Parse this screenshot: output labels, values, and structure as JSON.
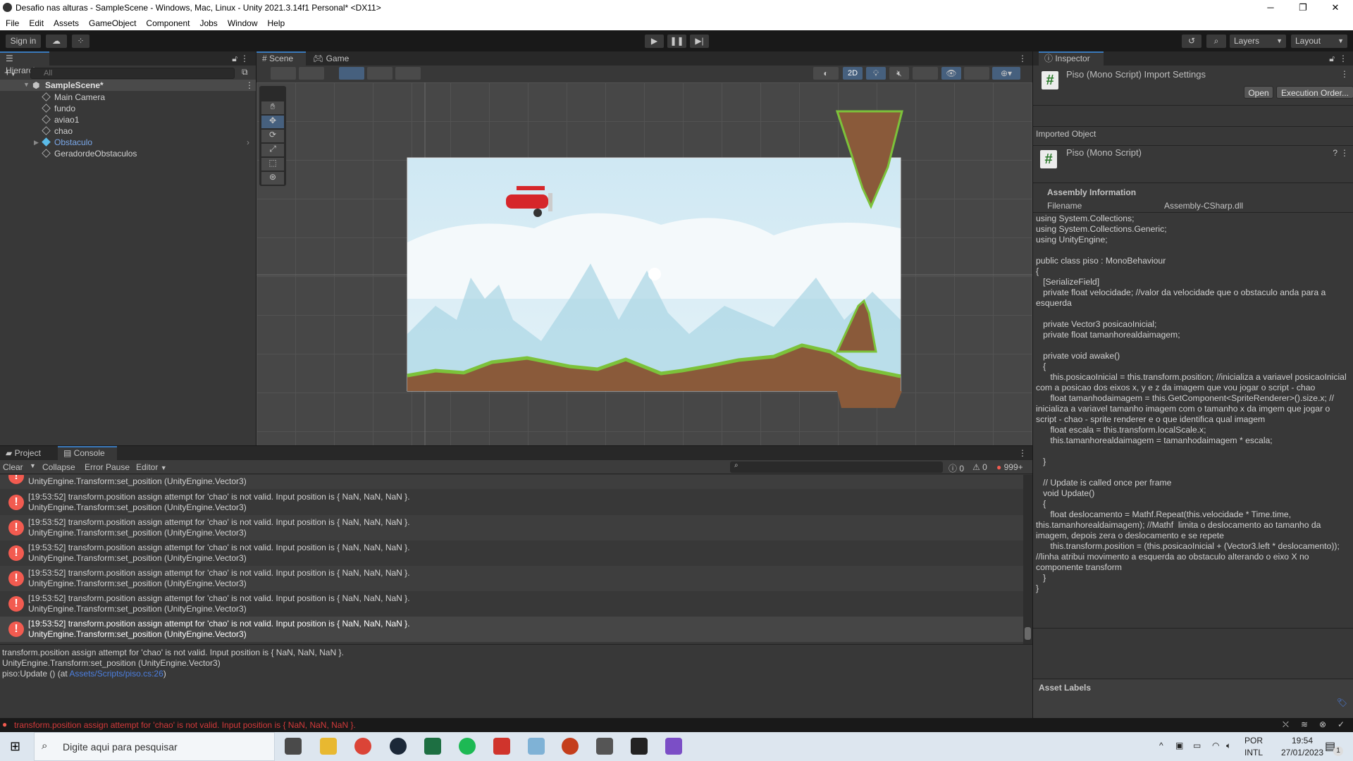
{
  "window": {
    "title": "Desafio nas alturas - SampleScene - Windows, Mac, Linux - Unity 2021.3.14f1 Personal* <DX11>",
    "minimize": "─",
    "maximize": "❐",
    "close": "✕"
  },
  "menu": [
    "File",
    "Edit",
    "Assets",
    "GameObject",
    "Component",
    "Jobs",
    "Window",
    "Help"
  ],
  "toolbar": {
    "sign_in": "Sign in",
    "layers": "Layers",
    "layout": "Layout"
  },
  "hierarchy": {
    "tab": "Hierarchy",
    "search_placeholder": "All",
    "scene": "SampleScene*",
    "items": [
      "Main Camera",
      "fundo",
      "aviao1",
      "chao",
      "Obstaculo",
      "GeradordeObstaculos"
    ]
  },
  "scene": {
    "tabs": [
      "Scene",
      "Game"
    ],
    "mode_2d": "2D"
  },
  "inspector": {
    "tab": "Inspector",
    "header": "Piso (Mono Script) Import Settings",
    "open": "Open",
    "execution_order": "Execution Order...",
    "imported_object": "Imported Object",
    "object_name": "Piso (Mono Script)",
    "assembly_info": "Assembly Information",
    "filename_label": "Filename",
    "filename_value": "Assembly-CSharp.dll",
    "asset_labels": "Asset Labels",
    "code": "using System.Collections;\nusing System.Collections.Generic;\nusing UnityEngine;\n\npublic class piso : MonoBehaviour\n{\n   [SerializeField]\n   private float velocidade; //valor da velocidade que o obstaculo anda para a esquerda\n\n   private Vector3 posicaoInicial;\n   private float tamanhorealdaimagem;\n\n   private void awake()\n   {\n      this.posicaoInicial = this.transform.position; //inicializa a variavel posicaoInicial com a posicao dos eixos x, y e z da imagem que vou jogar o script - chao\n      float tamanhodaimagem = this.GetComponent<SpriteRenderer>().size.x; // inicializa a variavel tamanho imagem com o tamanho x da imgem que jogar o script - chao - sprite renderer e o que identifica qual imagem\n      float escala = this.transform.localScale.x;\n      this.tamanhorealdaimagem = tamanhodaimagem * escala;\n\n   }\n\n   // Update is called once per frame\n   void Update()\n   {\n      float deslocamento = Mathf.Repeat(this.velocidade * Time.time, this.tamanhorealdaimagem); //Mathf  limita o deslocamento ao tamanho da imagem, depois zera o deslocamento e se repete\n      this.transform.position = (this.posicaoInicial + (Vector3.left * deslocamento)); //linha atribui movimento a esquerda ao obstaculo alterando o eixo X no componente transform\n   }\n}"
  },
  "console": {
    "tabs": [
      "Project",
      "Console"
    ],
    "clear": "Clear",
    "collapse": "Collapse",
    "error_pause": "Error Pause",
    "editor": "Editor",
    "log_count": "0",
    "warn_count": "0",
    "error_count": "999+",
    "partial_row": "UnityEngine.Transform:set_position (UnityEngine.Vector3)",
    "rows": [
      {
        "msg": "[19:53:52] transform.position assign attempt for 'chao' is not valid. Input position is { NaN, NaN, NaN }.",
        "trace": "UnityEngine.Transform:set_position (UnityEngine.Vector3)"
      },
      {
        "msg": "[19:53:52] transform.position assign attempt for 'chao' is not valid. Input position is { NaN, NaN, NaN }.",
        "trace": "UnityEngine.Transform:set_position (UnityEngine.Vector3)"
      },
      {
        "msg": "[19:53:52] transform.position assign attempt for 'chao' is not valid. Input position is { NaN, NaN, NaN }.",
        "trace": "UnityEngine.Transform:set_position (UnityEngine.Vector3)"
      },
      {
        "msg": "[19:53:52] transform.position assign attempt for 'chao' is not valid. Input position is { NaN, NaN, NaN }.",
        "trace": "UnityEngine.Transform:set_position (UnityEngine.Vector3)"
      },
      {
        "msg": "[19:53:52] transform.position assign attempt for 'chao' is not valid. Input position is { NaN, NaN, NaN }.",
        "trace": "UnityEngine.Transform:set_position (UnityEngine.Vector3)"
      },
      {
        "msg": "[19:53:52] transform.position assign attempt for 'chao' is not valid. Input position is { NaN, NaN, NaN }.",
        "trace": "UnityEngine.Transform:set_position (UnityEngine.Vector3)"
      }
    ],
    "detail": {
      "line1": "transform.position assign attempt for 'chao' is not valid. Input position is { NaN, NaN, NaN }.",
      "line2": "UnityEngine.Transform:set_position (UnityEngine.Vector3)",
      "line3_prefix": "piso:Update () (at ",
      "link": "Assets/Scripts/piso.cs:26",
      "line3_suffix": ")"
    }
  },
  "statusbar": {
    "message": "transform.position assign attempt for 'chao' is not valid. Input position is { NaN, NaN, NaN }."
  },
  "taskbar": {
    "search_placeholder": "Digite aqui para pesquisar",
    "lang1": "POR",
    "lang2": "INTL",
    "time": "19:54",
    "date": "27/01/2023",
    "notifications": "1"
  },
  "colors": {
    "accent": "#3a79bb",
    "error": "#f25b50",
    "link": "#4c7fe0",
    "selected_object": "#7aa7e8"
  }
}
